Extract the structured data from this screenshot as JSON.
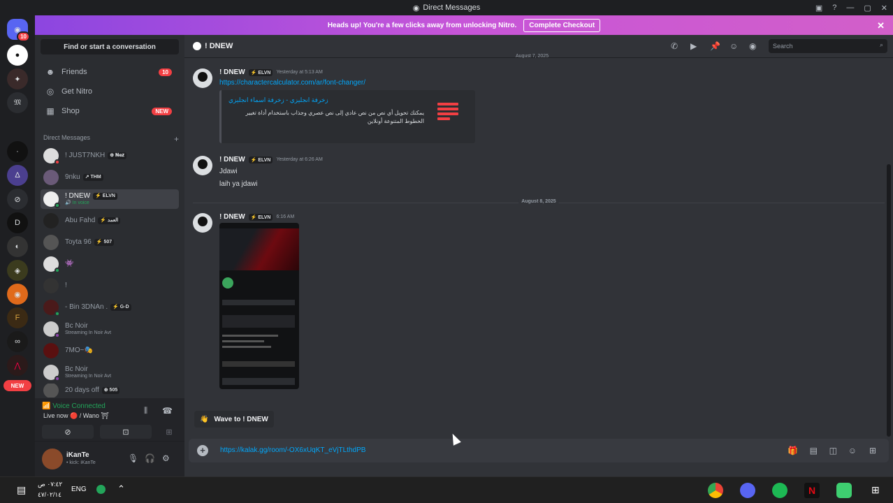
{
  "window": {
    "title": "Direct Messages"
  },
  "nitro_banner": {
    "text": "Heads up! You're a few clicks away from unlocking Nitro.",
    "cta": "Complete Checkout",
    "close": "✕"
  },
  "servers": {
    "home_badge": "10",
    "new_label": "NEW"
  },
  "sidebar": {
    "find_placeholder": "Find or start a conversation",
    "nav": [
      {
        "label": "Friends",
        "badge": "10"
      },
      {
        "label": "Get Nitro"
      },
      {
        "label": "Shop",
        "badge": "NEW"
      }
    ],
    "dm_header": "Direct Messages",
    "add": "+",
    "dms": [
      {
        "name": "! JUST7NKH",
        "tag": "⊕ 𝐍𝐞𝐳"
      },
      {
        "name": "9nku",
        "tag": "↗ THM"
      },
      {
        "name": "! DNEW",
        "tag": "⚡ ELVN",
        "sub": "🔊 In voice"
      },
      {
        "name": "Abu Fahd",
        "tag": "⚡ العمد"
      },
      {
        "name": "Toyta 96",
        "tag": "⚡ 507"
      },
      {
        "name": "👾"
      },
      {
        "name": "!"
      },
      {
        "name": "- Bin 3DNAn .",
        "tag": "⚡ G-D"
      },
      {
        "name": "Bc Noir",
        "sub": "Streaming In Noir Avt"
      },
      {
        "name": "7MO~🎭"
      },
      {
        "name": "Bc Noir",
        "sub": "Streaming In Noir Avt"
      },
      {
        "name": "20 days off",
        "tag": "⊕ 505"
      }
    ]
  },
  "voice": {
    "status": "Voice Connected",
    "location": "Live now 🔴 / Wano ⛩"
  },
  "user": {
    "name": "iKanTe",
    "status": "• kick: iKanTe"
  },
  "chat": {
    "title": "! DNEW",
    "search_placeholder": "Search",
    "top_date_partial": "August 7, 2025",
    "messages": [
      {
        "author": "! DNEW",
        "tag": "⚡ ELVN",
        "time": "Yesterday at 5:13 AM",
        "link": "https://charactercalculator.com/ar/font-changer/",
        "embed_title": "زخرفة انجليزي - زخرفة اسماء انجليزي",
        "embed_desc": "يمكنك تحويل أي نص من نص عادي إلى نص عصري وجذاب باستخدام أداة تغيير الخطوط المتنوعة أونلاين"
      },
      {
        "author": "! DNEW",
        "tag": "⚡ ELVN",
        "time": "Yesterday at 6:26 AM",
        "lines": [
          "Jdawi",
          "laih ya jdawi"
        ]
      },
      {
        "author": "! DNEW",
        "tag": "⚡ ELVN",
        "time": "6:16 AM"
      }
    ],
    "divider_date": "August 8, 2025",
    "wave_label": "Wave to ! DNEW",
    "composer_value": "https://kalak.gg/room/-OX6xUqKT_eVjTLthdPB"
  },
  "taskbar": {
    "time": "٠٧:٤٢ ص",
    "date": "٤٧/٠٢/١٤",
    "lang": "ENG"
  },
  "colors": {
    "accent": "#5865f2",
    "danger": "#f23f43",
    "online": "#23a55a",
    "link": "#00a8fc"
  }
}
